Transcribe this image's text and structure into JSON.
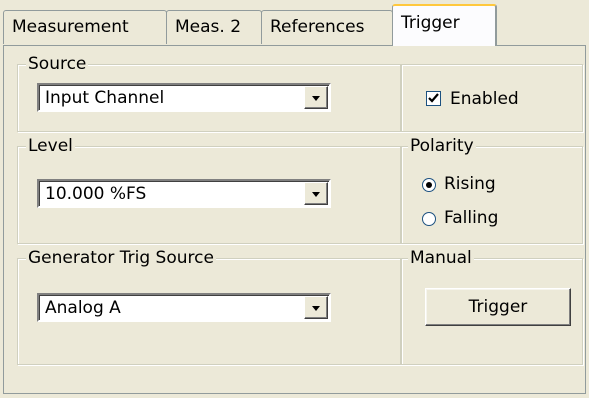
{
  "tabs": [
    {
      "label": "Measurement",
      "active": false
    },
    {
      "label": "Meas. 2",
      "active": false
    },
    {
      "label": "References",
      "active": false
    },
    {
      "label": "Trigger",
      "active": true
    }
  ],
  "source": {
    "legend": "Source",
    "value": "Input Channel"
  },
  "enabled": {
    "label": "Enabled",
    "checked": true
  },
  "level": {
    "legend": "Level",
    "value": "10.000 %FS"
  },
  "polarity": {
    "legend": "Polarity",
    "options": [
      {
        "label": "Rising",
        "selected": true
      },
      {
        "label": "Falling",
        "selected": false
      }
    ]
  },
  "generator": {
    "legend": "Generator Trig Source",
    "value": "Analog A"
  },
  "manual": {
    "legend": "Manual",
    "button_label": "Trigger"
  },
  "icons": {
    "dropdown": "chevron-down-icon",
    "check": "checkmark-icon"
  },
  "colors": {
    "background": "#ece9d8",
    "active_tab_accent": "#ffc83c",
    "border": "#919b9c"
  }
}
